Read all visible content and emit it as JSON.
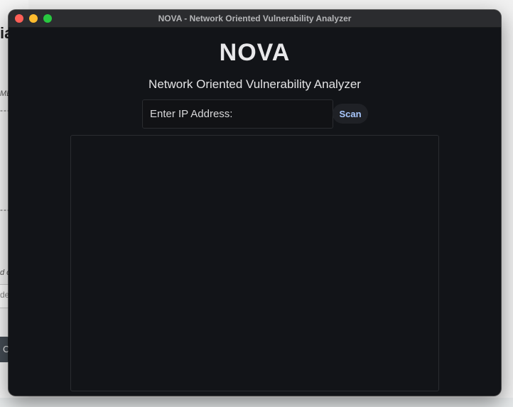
{
  "window": {
    "title": "NOVA - Network Oriented Vulnerability Analyzer"
  },
  "app": {
    "title": "NOVA",
    "subtitle": "Network Oriented Vulnerability Analyzer"
  },
  "ip_input": {
    "value": "",
    "placeholder": "Enter IP Address:"
  },
  "scan_button": {
    "label": "Scan"
  },
  "output": {
    "text": ""
  },
  "background_app": {
    "title_fragment": "ia",
    "small_fragment": "ME",
    "dash_fragment_1": "---",
    "dash_fragment_2": "---",
    "small_fragment_2": "d o",
    "input_fragment": "de",
    "button_fragment": "C"
  },
  "colors": {
    "window_bg": "#121418",
    "titlebar_bg": "#2b2c2f",
    "accent_text": "#a9c8ff",
    "traffic_close": "#fe5f57",
    "traffic_minimize": "#febc2e",
    "traffic_maximize": "#28c840"
  }
}
